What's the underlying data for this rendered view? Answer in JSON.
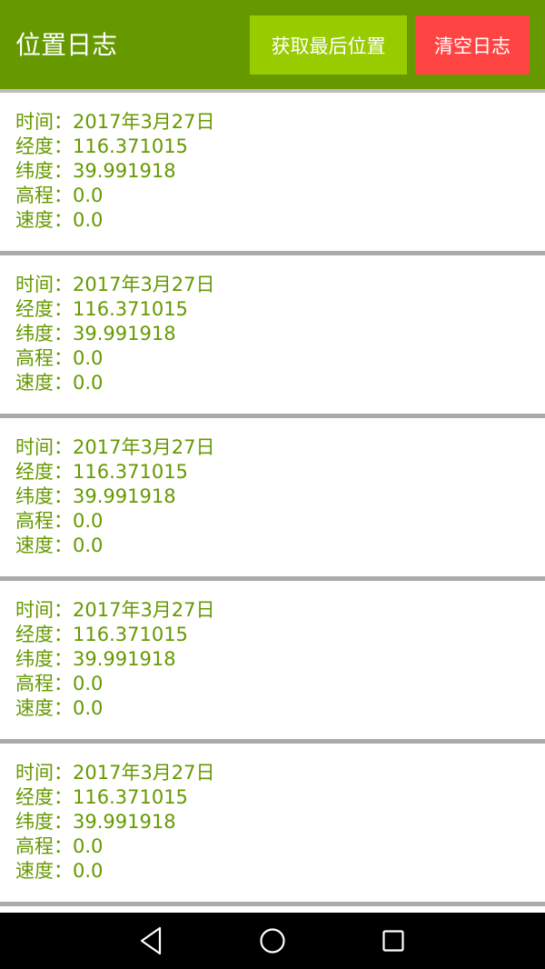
{
  "app_bar": {
    "title": "位置日志",
    "latest_button_label": "获取最后位置",
    "clear_button_label": "清空日志",
    "colors": {
      "bar": "#669900",
      "latest_button": "#99cc00",
      "clear_button": "#ff4444"
    }
  },
  "log_entries": [
    {
      "time_line": "时间：2017年3月27日",
      "longitude_line": "经度：116.371015",
      "latitude_line": "纬度：39.991918",
      "altitude_line": "高程：0.0",
      "speed_line": "速度：0.0"
    },
    {
      "time_line": "时间：2017年3月27日",
      "longitude_line": "经度：116.371015",
      "latitude_line": "纬度：39.991918",
      "altitude_line": "高程：0.0",
      "speed_line": "速度：0.0"
    },
    {
      "time_line": "时间：2017年3月27日",
      "longitude_line": "经度：116.371015",
      "latitude_line": "纬度：39.991918",
      "altitude_line": "高程：0.0",
      "speed_line": "速度：0.0"
    },
    {
      "time_line": "时间：2017年3月27日",
      "longitude_line": "经度：116.371015",
      "latitude_line": "纬度：39.991918",
      "altitude_line": "高程：0.0",
      "speed_line": "速度：0.0"
    },
    {
      "time_line": "时间：2017年3月27日",
      "longitude_line": "经度：116.371015",
      "latitude_line": "纬度：39.991918",
      "altitude_line": "高程：0.0",
      "speed_line": "速度：0.0"
    }
  ],
  "text_color": "#669900",
  "nav_bar": {
    "back_icon": "back-triangle-icon",
    "home_icon": "home-circle-icon",
    "recents_icon": "recents-square-icon"
  }
}
